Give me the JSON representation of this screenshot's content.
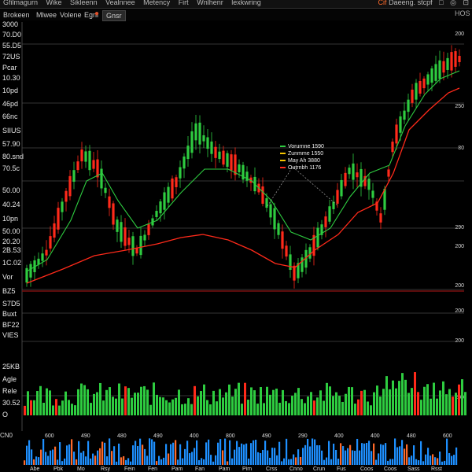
{
  "menu": {
    "logo": "Brokeen",
    "items": [
      "Gfilmagurn",
      "Wike",
      "Sikleenn",
      "Vealnnee",
      "Metency",
      "Firt",
      "Wnlhenr",
      "lexkwring"
    ]
  },
  "topright": {
    "symbol": "Cif",
    "label": "Daeeng. stcpf",
    "icons": [
      "□",
      "◎",
      "⊡"
    ]
  },
  "tabs": [
    "Bvseinen",
    "Mlwee",
    "Volene",
    "Egnl",
    "Gnsr"
  ],
  "tabs_right": "HOS",
  "left_axis_labels": [
    "3000",
    "70.D0",
    "55.D5",
    "72US",
    "Pcar",
    "10.30",
    "10pd",
    "46pd",
    "66nc",
    "SIIUS",
    "57.90",
    "80.snd",
    "70.5c",
    "50.00",
    "40.24",
    "10pn",
    "50.00",
    "20.20",
    "2B.53",
    "1C.02",
    "Vor",
    "BZ5",
    "S7D5",
    "Buxt",
    "BF22",
    "VIES",
    "25KB",
    "Agle",
    "Rele",
    "30.52",
    "O"
  ],
  "right_axis_labels": [
    "200",
    "250",
    "80",
    "290",
    "200",
    "200",
    "200",
    "200",
    "200"
  ],
  "legend": [
    {
      "label": "Vorurnne 1590",
      "color": "#2ecc40"
    },
    {
      "label": "Zunmme 1550",
      "color": "#f5c400"
    },
    {
      "label": "May Ah 3880",
      "color": "#f5c400"
    },
    {
      "label": "Outrnbh 1176",
      "color": "#ff2a1a"
    }
  ],
  "x_labels_top": [
    "600",
    "490",
    "480",
    "490",
    "400",
    "800",
    "490",
    "290",
    "400",
    "400",
    "480",
    "600"
  ],
  "x_labels_bottom": [
    "Abe",
    "Pbk",
    "Mo",
    "Rsy",
    "Fein",
    "Fen",
    "Pam",
    "Fan",
    "Pam",
    "Pim",
    "Crss",
    "Cnno",
    "Crun",
    "Fus",
    "Coos",
    "Coos",
    "Sass",
    "Rsst"
  ],
  "cn_label": "CN0",
  "colors": {
    "up": "#2ecc40",
    "down": "#ff2a1a",
    "ema_fast": "#2ecc40",
    "ema_slow": "#ff2a1a",
    "vol2_a": "#1e90ff",
    "vol2_b": "#ff6a2a"
  }
}
